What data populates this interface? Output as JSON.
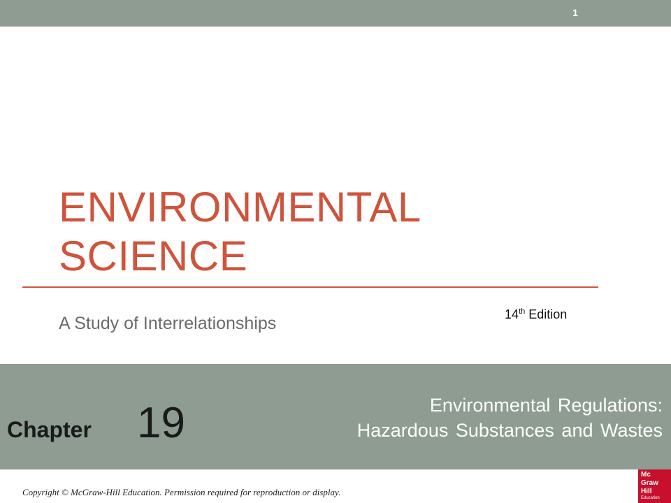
{
  "slide": {
    "number": "1",
    "title_line1": "ENVIRONMENTAL",
    "title_line2": "SCIENCE",
    "subtitle": "A Study of Interrelationships",
    "edition_number": "14",
    "edition_suffix": "th",
    "edition_word": "Edition"
  },
  "chapter": {
    "label": "Chapter",
    "number": "19",
    "title_line1": "Environmental Regulations:",
    "title_line2": "Hazardous Substances and Wastes"
  },
  "footer": {
    "copyright": "Copyright © McGraw-Hill Education. Permission required for reproduction or display.",
    "logo_line1": "Mc",
    "logo_line2": "Graw",
    "logo_line3": "Hill",
    "logo_line4": "Education"
  },
  "colors": {
    "band": "#8e9c91",
    "title": "#d0533c",
    "logo": "#c8102e"
  }
}
